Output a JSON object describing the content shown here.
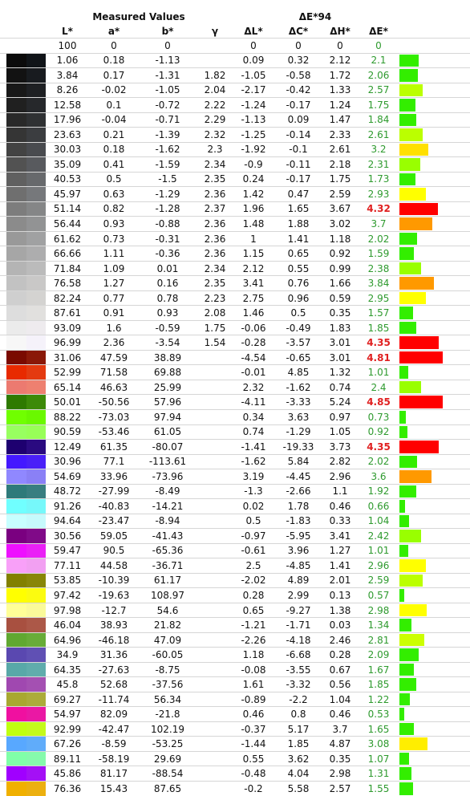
{
  "header": {
    "measured_title": "Measured Values",
    "delta_title": "ΔE*94",
    "columns": [
      "L*",
      "a*",
      "b*",
      "γ",
      "ΔL*",
      "ΔC*",
      "ΔH*",
      "ΔE*"
    ]
  },
  "rows": [
    {
      "c1": "#ffffff",
      "c2": "#ffffff",
      "L": "100",
      "a": "0",
      "b": "0",
      "g": "",
      "dL": "0",
      "dC": "0",
      "dH": "0",
      "dE": "0",
      "bar": 0,
      "barColor": ""
    },
    {
      "c1": "#0b0b0b",
      "c2": "#101418",
      "L": "1.06",
      "a": "0.18",
      "b": "-1.13",
      "g": "",
      "dL": "0.09",
      "dC": "0.32",
      "dH": "2.12",
      "dE": "2.1",
      "bar": 0.42,
      "barColor": "#33ee00"
    },
    {
      "c1": "#121212",
      "c2": "#181b1f",
      "L": "3.84",
      "a": "0.17",
      "b": "-1.31",
      "g": "1.82",
      "dL": "-1.05",
      "dC": "-0.58",
      "dH": "1.72",
      "dE": "2.06",
      "bar": 0.41,
      "barColor": "#33ee00"
    },
    {
      "c1": "#181818",
      "c2": "#1e2023",
      "L": "8.26",
      "a": "-0.02",
      "b": "-1.05",
      "g": "2.04",
      "dL": "-2.17",
      "dC": "-0.42",
      "dH": "1.33",
      "dE": "2.57",
      "bar": 0.51,
      "barColor": "#bbff00"
    },
    {
      "c1": "#202020",
      "c2": "#26282b",
      "L": "12.58",
      "a": "0.1",
      "b": "-0.72",
      "g": "2.22",
      "dL": "-1.24",
      "dC": "-0.17",
      "dH": "1.24",
      "dE": "1.75",
      "bar": 0.35,
      "barColor": "#33ee00"
    },
    {
      "c1": "#292929",
      "c2": "#2f3133",
      "L": "17.96",
      "a": "-0.04",
      "b": "-0.71",
      "g": "2.29",
      "dL": "-1.13",
      "dC": "0.09",
      "dH": "1.47",
      "dE": "1.84",
      "bar": 0.37,
      "barColor": "#33ee00"
    },
    {
      "c1": "#353535",
      "c2": "#3b3d40",
      "L": "23.63",
      "a": "0.21",
      "b": "-1.39",
      "g": "2.32",
      "dL": "-1.25",
      "dC": "-0.14",
      "dH": "2.33",
      "dE": "2.61",
      "bar": 0.52,
      "barColor": "#bbff00"
    },
    {
      "c1": "#434343",
      "c2": "#494b4f",
      "L": "30.03",
      "a": "0.18",
      "b": "-1.62",
      "g": "2.3",
      "dL": "-1.92",
      "dC": "-0.1",
      "dH": "2.61",
      "dE": "3.2",
      "bar": 0.64,
      "barColor": "#ffe000"
    },
    {
      "c1": "#525252",
      "c2": "#585a5e",
      "L": "35.09",
      "a": "0.41",
      "b": "-1.59",
      "g": "2.34",
      "dL": "-0.9",
      "dC": "-0.11",
      "dH": "2.18",
      "dE": "2.31",
      "bar": 0.46,
      "barColor": "#99ff00"
    },
    {
      "c1": "#606060",
      "c2": "#67696c",
      "L": "40.53",
      "a": "0.5",
      "b": "-1.5",
      "g": "2.35",
      "dL": "0.24",
      "dC": "-0.17",
      "dH": "1.75",
      "dE": "1.73",
      "bar": 0.35,
      "barColor": "#33ee00"
    },
    {
      "c1": "#6f6f6f",
      "c2": "#76787b",
      "L": "45.97",
      "a": "0.63",
      "b": "-1.29",
      "g": "2.36",
      "dL": "1.42",
      "dC": "0.47",
      "dH": "2.59",
      "dE": "2.93",
      "bar": 0.59,
      "barColor": "#ffff00"
    },
    {
      "c1": "#7d7d7d",
      "c2": "#858687",
      "L": "51.14",
      "a": "0.82",
      "b": "-1.28",
      "g": "2.37",
      "dL": "1.96",
      "dC": "1.65",
      "dH": "3.67",
      "dE": "4.32",
      "bar": 0.86,
      "barColor": "#ff0000"
    },
    {
      "c1": "#8b8b8b",
      "c2": "#929394",
      "L": "56.44",
      "a": "0.93",
      "b": "-0.88",
      "g": "2.36",
      "dL": "1.48",
      "dC": "1.88",
      "dH": "3.02",
      "dE": "3.7",
      "bar": 0.74,
      "barColor": "#ff9900"
    },
    {
      "c1": "#999999",
      "c2": "#a0a1a2",
      "L": "61.62",
      "a": "0.73",
      "b": "-0.31",
      "g": "2.36",
      "dL": "1",
      "dC": "1.41",
      "dH": "1.18",
      "dE": "2.02",
      "bar": 0.4,
      "barColor": "#33ee00"
    },
    {
      "c1": "#a6a6a6",
      "c2": "#adadae",
      "L": "66.66",
      "a": "1.11",
      "b": "-0.36",
      "g": "2.36",
      "dL": "1.15",
      "dC": "0.65",
      "dH": "0.92",
      "dE": "1.59",
      "bar": 0.32,
      "barColor": "#33ee00"
    },
    {
      "c1": "#b4b4b4",
      "c2": "#bbbbbb",
      "L": "71.84",
      "a": "1.09",
      "b": "0.01",
      "g": "2.34",
      "dL": "2.12",
      "dC": "0.55",
      "dH": "0.99",
      "dE": "2.38",
      "bar": 0.48,
      "barColor": "#99ff00"
    },
    {
      "c1": "#c2c2c2",
      "c2": "#c9c8c7",
      "L": "76.58",
      "a": "1.27",
      "b": "0.16",
      "g": "2.35",
      "dL": "3.41",
      "dC": "0.76",
      "dH": "1.66",
      "dE": "3.84",
      "bar": 0.77,
      "barColor": "#ff9900"
    },
    {
      "c1": "#cfcfcf",
      "c2": "#d4d3d1",
      "L": "82.24",
      "a": "0.77",
      "b": "0.78",
      "g": "2.23",
      "dL": "2.75",
      "dC": "0.96",
      "dH": "0.59",
      "dE": "2.95",
      "bar": 0.59,
      "barColor": "#ffff00"
    },
    {
      "c1": "#dddddd",
      "c2": "#e1e0de",
      "L": "87.61",
      "a": "0.91",
      "b": "0.93",
      "g": "2.08",
      "dL": "1.46",
      "dC": "0.5",
      "dH": "0.35",
      "dE": "1.57",
      "bar": 0.31,
      "barColor": "#33ee00"
    },
    {
      "c1": "#ebebeb",
      "c2": "#eeebee",
      "L": "93.09",
      "a": "1.6",
      "b": "-0.59",
      "g": "1.75",
      "dL": "-0.06",
      "dC": "-0.49",
      "dH": "1.83",
      "dE": "1.85",
      "bar": 0.37,
      "barColor": "#33ee00"
    },
    {
      "c1": "#f7f7f7",
      "c2": "#f5f2fa",
      "L": "96.99",
      "a": "2.36",
      "b": "-3.54",
      "g": "1.54",
      "dL": "-0.28",
      "dC": "-3.57",
      "dH": "3.01",
      "dE": "4.35",
      "bar": 0.87,
      "barColor": "#ff0000"
    },
    {
      "c1": "#7a0a00",
      "c2": "#8a1808",
      "L": "31.06",
      "a": "47.59",
      "b": "38.89",
      "g": "",
      "dL": "-4.54",
      "dC": "-0.65",
      "dH": "3.01",
      "dE": "4.81",
      "bar": 0.96,
      "barColor": "#ff0000"
    },
    {
      "c1": "#e82a00",
      "c2": "#e43a10",
      "L": "52.99",
      "a": "71.58",
      "b": "69.88",
      "g": "",
      "dL": "-0.01",
      "dC": "4.85",
      "dH": "1.32",
      "dE": "1.01",
      "bar": 0.2,
      "barColor": "#33ee00"
    },
    {
      "c1": "#ec7a70",
      "c2": "#ee8070",
      "L": "65.14",
      "a": "46.63",
      "b": "25.99",
      "g": "",
      "dL": "2.32",
      "dC": "-1.62",
      "dH": "0.74",
      "dE": "2.4",
      "bar": 0.48,
      "barColor": "#99ff00"
    },
    {
      "c1": "#2e7a00",
      "c2": "#3c8a08",
      "L": "50.01",
      "a": "-50.56",
      "b": "57.96",
      "g": "",
      "dL": "-4.11",
      "dC": "-3.33",
      "dH": "5.24",
      "dE": "4.85",
      "bar": 0.97,
      "barColor": "#ff0000"
    },
    {
      "c1": "#70ff00",
      "c2": "#6af800",
      "L": "88.22",
      "a": "-73.03",
      "b": "97.94",
      "g": "",
      "dL": "0.34",
      "dC": "3.63",
      "dH": "0.97",
      "dE": "0.73",
      "bar": 0.15,
      "barColor": "#33ee00"
    },
    {
      "c1": "#98ff60",
      "c2": "#98ff58",
      "L": "90.59",
      "a": "-53.46",
      "b": "61.05",
      "g": "",
      "dL": "0.74",
      "dC": "-1.29",
      "dH": "1.05",
      "dE": "0.92",
      "bar": 0.18,
      "barColor": "#33ee00"
    },
    {
      "c1": "#1e0070",
      "c2": "#2a0a80",
      "L": "12.49",
      "a": "61.35",
      "b": "-80.07",
      "g": "",
      "dL": "-1.41",
      "dC": "-19.33",
      "dH": "3.73",
      "dE": "4.35",
      "bar": 0.87,
      "barColor": "#ff0000"
    },
    {
      "c1": "#4418ff",
      "c2": "#4a20f8",
      "L": "30.96",
      "a": "77.1",
      "b": "-113.61",
      "g": "",
      "dL": "-1.62",
      "dC": "5.84",
      "dH": "2.82",
      "dE": "2.02",
      "bar": 0.4,
      "barColor": "#33ee00"
    },
    {
      "c1": "#9088ff",
      "c2": "#8a80f6",
      "L": "54.69",
      "a": "33.96",
      "b": "-73.96",
      "g": "",
      "dL": "3.19",
      "dC": "-4.45",
      "dH": "2.96",
      "dE": "3.6",
      "bar": 0.72,
      "barColor": "#ff9900"
    },
    {
      "c1": "#2e7a7a",
      "c2": "#387e80",
      "L": "48.72",
      "a": "-27.99",
      "b": "-8.49",
      "g": "",
      "dL": "-1.3",
      "dC": "-2.66",
      "dH": "1.1",
      "dE": "1.92",
      "bar": 0.38,
      "barColor": "#33ee00"
    },
    {
      "c1": "#70ffff",
      "c2": "#76f8fa",
      "L": "91.26",
      "a": "-40.83",
      "b": "-14.21",
      "g": "",
      "dL": "0.02",
      "dC": "1.78",
      "dH": "0.46",
      "dE": "0.66",
      "bar": 0.13,
      "barColor": "#33ee00"
    },
    {
      "c1": "#c8ffff",
      "c2": "#c6fafc",
      "L": "94.64",
      "a": "-23.47",
      "b": "-8.94",
      "g": "",
      "dL": "0.5",
      "dC": "-1.83",
      "dH": "0.33",
      "dE": "1.04",
      "bar": 0.21,
      "barColor": "#33ee00"
    },
    {
      "c1": "#7a0080",
      "c2": "#800a88",
      "L": "30.56",
      "a": "59.05",
      "b": "-41.43",
      "g": "",
      "dL": "-0.97",
      "dC": "-5.95",
      "dH": "3.41",
      "dE": "2.42",
      "bar": 0.48,
      "barColor": "#99ff00"
    },
    {
      "c1": "#ee10ff",
      "c2": "#ea20f6",
      "L": "59.47",
      "a": "90.5",
      "b": "-65.36",
      "g": "",
      "dL": "-0.61",
      "dC": "3.96",
      "dH": "1.27",
      "dE": "1.01",
      "bar": 0.2,
      "barColor": "#33ee00"
    },
    {
      "c1": "#f8a0f8",
      "c2": "#f2a0f2",
      "L": "77.11",
      "a": "44.58",
      "b": "-36.71",
      "g": "",
      "dL": "2.5",
      "dC": "-4.85",
      "dH": "1.41",
      "dE": "2.96",
      "bar": 0.59,
      "barColor": "#ffff00"
    },
    {
      "c1": "#828000",
      "c2": "#888608",
      "L": "53.85",
      "a": "-10.39",
      "b": "61.17",
      "g": "",
      "dL": "-2.02",
      "dC": "4.89",
      "dH": "2.01",
      "dE": "2.59",
      "bar": 0.52,
      "barColor": "#bbff00"
    },
    {
      "c1": "#ffff00",
      "c2": "#fbfb10",
      "L": "97.42",
      "a": "-19.63",
      "b": "108.97",
      "g": "",
      "dL": "0.28",
      "dC": "2.99",
      "dH": "0.13",
      "dE": "0.57",
      "bar": 0.11,
      "barColor": "#33ee00"
    },
    {
      "c1": "#ffff98",
      "c2": "#fafa9a",
      "L": "97.98",
      "a": "-12.7",
      "b": "54.6",
      "g": "",
      "dL": "0.65",
      "dC": "-9.27",
      "dH": "1.38",
      "dE": "2.98",
      "bar": 0.6,
      "barColor": "#ffff00"
    },
    {
      "c1": "#a85040",
      "c2": "#ac5848",
      "L": "46.04",
      "a": "38.93",
      "b": "21.82",
      "g": "",
      "dL": "-1.21",
      "dC": "-1.71",
      "dH": "0.03",
      "dE": "1.34",
      "bar": 0.27,
      "barColor": "#33ee00"
    },
    {
      "c1": "#60a830",
      "c2": "#68ac38",
      "L": "64.96",
      "a": "-46.18",
      "b": "47.09",
      "g": "",
      "dL": "-2.26",
      "dC": "-4.18",
      "dH": "2.46",
      "dE": "2.81",
      "bar": 0.56,
      "barColor": "#ccff00"
    },
    {
      "c1": "#5a48b0",
      "c2": "#6050b4",
      "L": "34.9",
      "a": "31.36",
      "b": "-60.05",
      "g": "",
      "dL": "1.18",
      "dC": "-6.68",
      "dH": "0.28",
      "dE": "2.09",
      "bar": 0.42,
      "barColor": "#33ee00"
    },
    {
      "c1": "#58a8a8",
      "c2": "#60acac",
      "L": "64.35",
      "a": "-27.63",
      "b": "-8.75",
      "g": "",
      "dL": "-0.08",
      "dC": "-3.55",
      "dH": "0.67",
      "dE": "1.67",
      "bar": 0.33,
      "barColor": "#33ee00"
    },
    {
      "c1": "#a048b0",
      "c2": "#a450b2",
      "L": "45.8",
      "a": "52.68",
      "b": "-37.56",
      "g": "",
      "dL": "1.61",
      "dC": "-3.32",
      "dH": "0.56",
      "dE": "1.85",
      "bar": 0.37,
      "barColor": "#33ee00"
    },
    {
      "c1": "#a8a830",
      "c2": "#acac3a",
      "L": "69.27",
      "a": "-11.74",
      "b": "56.34",
      "g": "",
      "dL": "-0.89",
      "dC": "-2.2",
      "dH": "1.04",
      "dE": "1.22",
      "bar": 0.24,
      "barColor": "#33ee00"
    },
    {
      "c1": "#f010a0",
      "c2": "#ea18a4",
      "L": "54.97",
      "a": "82.09",
      "b": "-21.8",
      "g": "",
      "dL": "0.46",
      "dC": "0.8",
      "dH": "0.46",
      "dE": "0.53",
      "bar": 0.11,
      "barColor": "#33ee00"
    },
    {
      "c1": "#c0ff10",
      "c2": "#c4fa1c",
      "L": "92.99",
      "a": "-42.47",
      "b": "102.19",
      "g": "",
      "dL": "-0.37",
      "dC": "5.17",
      "dH": "3.7",
      "dE": "1.65",
      "bar": 0.33,
      "barColor": "#33ee00"
    },
    {
      "c1": "#58a8ff",
      "c2": "#60acfa",
      "L": "67.26",
      "a": "-8.59",
      "b": "-53.25",
      "g": "",
      "dL": "-1.44",
      "dC": "1.85",
      "dH": "4.87",
      "dE": "3.08",
      "bar": 0.62,
      "barColor": "#ffee00"
    },
    {
      "c1": "#80ffa8",
      "c2": "#86faac",
      "L": "89.11",
      "a": "-58.19",
      "b": "29.69",
      "g": "",
      "dL": "0.55",
      "dC": "3.62",
      "dH": "0.35",
      "dE": "1.07",
      "bar": 0.21,
      "barColor": "#33ee00"
    },
    {
      "c1": "#a000ff",
      "c2": "#a410f6",
      "L": "45.86",
      "a": "81.17",
      "b": "-88.54",
      "g": "",
      "dL": "-0.48",
      "dC": "4.04",
      "dH": "2.98",
      "dE": "1.31",
      "bar": 0.26,
      "barColor": "#33ee00"
    },
    {
      "c1": "#f0b000",
      "c2": "#ecb010",
      "L": "76.36",
      "a": "15.43",
      "b": "87.65",
      "g": "",
      "dL": "-0.2",
      "dC": "5.58",
      "dH": "2.57",
      "dE": "1.55",
      "bar": 0.31,
      "barColor": "#33ee00"
    }
  ]
}
